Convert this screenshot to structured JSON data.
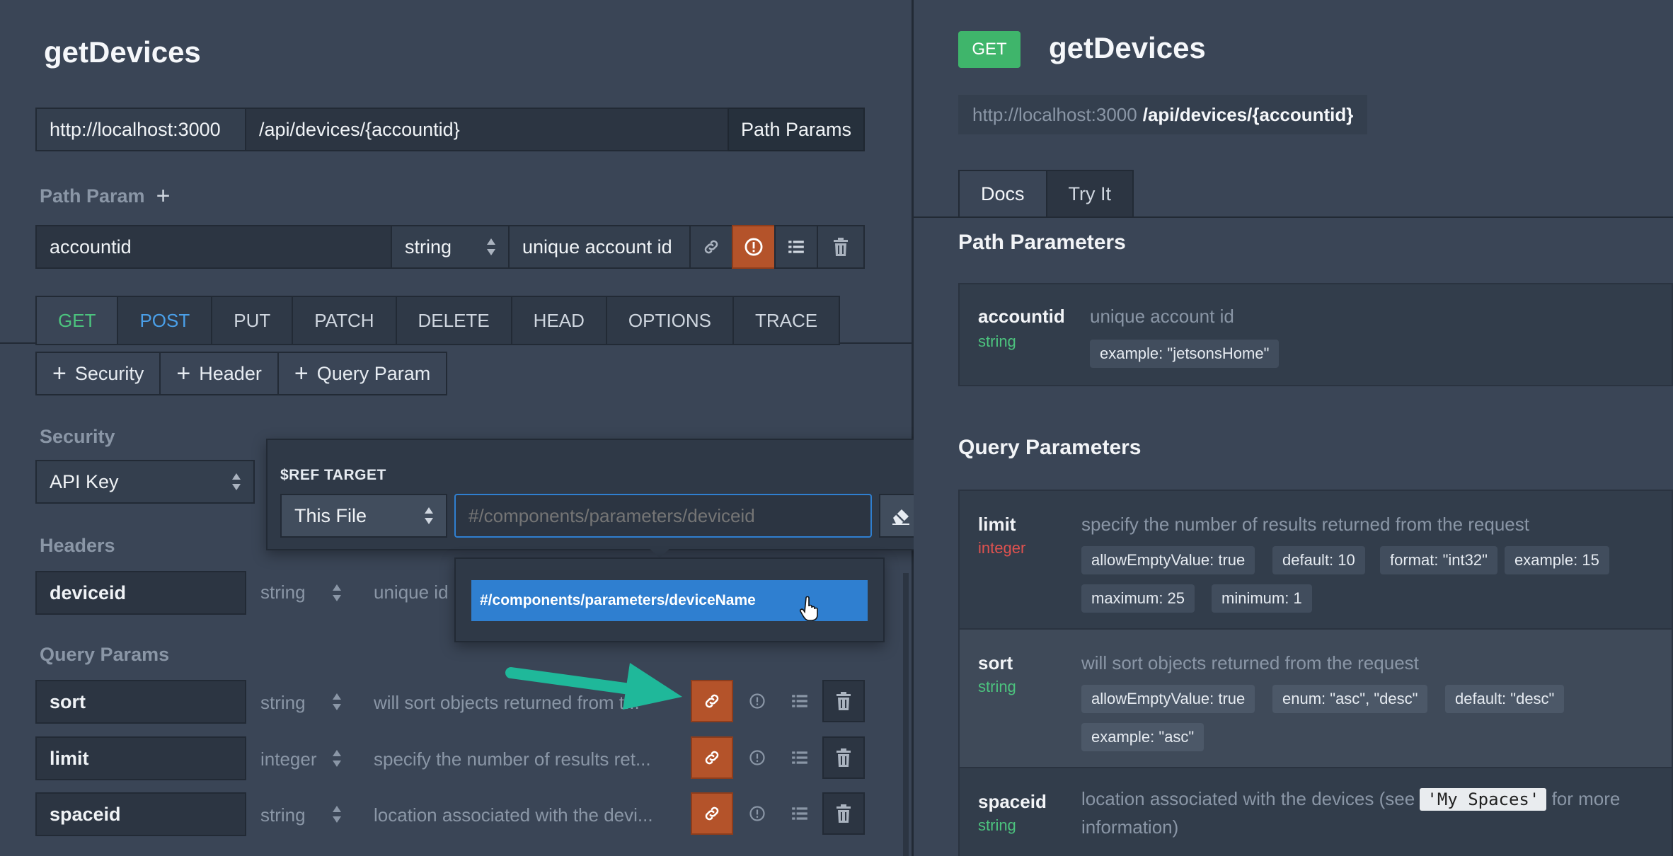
{
  "left": {
    "title": "getDevices",
    "server_url": "http://localhost:3000",
    "path": "/api/devices/{accountid}",
    "path_params_button": "Path Params",
    "path_param_label": "Path Param",
    "path_param": {
      "name": "accountid",
      "type": "string",
      "description": "unique account id"
    },
    "methods": [
      "GET",
      "POST",
      "PUT",
      "PATCH",
      "DELETE",
      "HEAD",
      "OPTIONS",
      "TRACE"
    ],
    "add_buttons": [
      "Security",
      "Header",
      "Query Param"
    ],
    "security_label": "Security",
    "security_value": "API Key",
    "headers_label": "Headers",
    "header": {
      "name": "deviceid",
      "type": "string",
      "description": "unique id"
    },
    "query_label": "Query Params",
    "query_params": [
      {
        "name": "sort",
        "type": "string",
        "description": "will sort objects returned from t..."
      },
      {
        "name": "limit",
        "type": "integer",
        "description": "specify the number of results ret..."
      },
      {
        "name": "spaceid",
        "type": "string",
        "description": "location associated with the devi..."
      }
    ]
  },
  "ref_popover": {
    "title": "$REF TARGET",
    "source": "This File",
    "placeholder": "#/components/parameters/deviceid",
    "suggestion": "#/components/parameters/deviceName"
  },
  "right": {
    "method": "GET",
    "title": "getDevices",
    "server_url": "http://localhost:3000",
    "path": "/api/devices/{accountid}",
    "tabs": [
      "Docs",
      "Try It"
    ],
    "path_section": "Path Parameters",
    "path_param": {
      "name": "accountid",
      "type": "string",
      "description": "unique account id",
      "chips": [
        "example: \"jetsonsHome\""
      ]
    },
    "query_section": "Query Parameters",
    "query_params": [
      {
        "name": "limit",
        "type": "integer",
        "description": "specify the number of results returned from the request",
        "chips": [
          "allowEmptyValue: true",
          "default: 10",
          "format: \"int32\"",
          "example: 15",
          "maximum: 25",
          "minimum: 1"
        ]
      },
      {
        "name": "sort",
        "type": "string",
        "description": "will sort objects returned from the request",
        "chips": [
          "allowEmptyValue: true",
          "enum: \"asc\", \"desc\"",
          "default: \"desc\"",
          "example: \"asc\""
        ]
      },
      {
        "name": "spaceid",
        "type": "string",
        "description_pre": "location associated with the devices (see",
        "description_code": "'My Spaces'",
        "description_post": "for more",
        "description_line2": "information)"
      }
    ]
  },
  "colors": {
    "get": "#3fb56b",
    "post": "#4a9fe8",
    "integer": "#e0524f",
    "string": "#4cc37e",
    "orange": "#b4532a",
    "accent_arrow": "#1fb89a"
  }
}
